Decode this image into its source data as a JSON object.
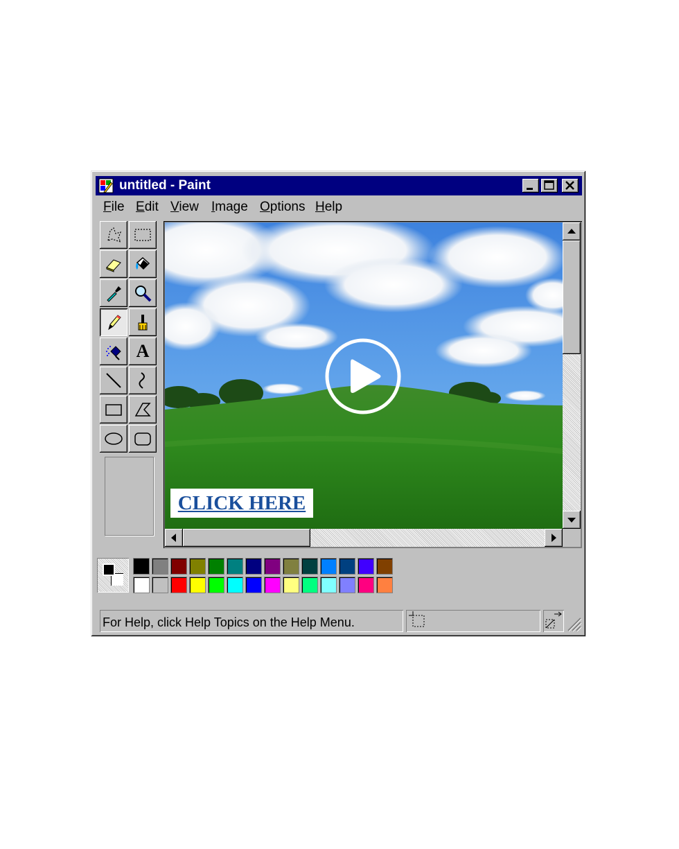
{
  "window": {
    "title": "untitled - Paint",
    "menu": [
      {
        "label": "File"
      },
      {
        "label": "Edit"
      },
      {
        "label": "View"
      },
      {
        "label": "Image"
      },
      {
        "label": "Options"
      },
      {
        "label": "Help"
      }
    ]
  },
  "toolbox": {
    "tools": [
      "free-form-select",
      "rectangle-select",
      "eraser",
      "fill-with-color",
      "pick-color",
      "magnifier",
      "pencil",
      "brush",
      "airbrush",
      "text",
      "line",
      "curve",
      "rectangle",
      "polygon",
      "ellipse",
      "rounded-rectangle"
    ],
    "active_tool": "pencil",
    "text_tool_glyph": "A"
  },
  "canvas": {
    "link_text": "CLICK HERE",
    "play_icon": "play-icon",
    "scene": "green hill under blue sky with clouds"
  },
  "palette": {
    "foreground": "#000000",
    "background": "#ffffff",
    "top_row": [
      "#000000",
      "#808080",
      "#800000",
      "#808000",
      "#008000",
      "#008080",
      "#000080",
      "#800080",
      "#808040",
      "#004040",
      "#0080ff",
      "#004080",
      "#4000ff",
      "#804000"
    ],
    "bottom_row": [
      "#ffffff",
      "#c0c0c0",
      "#ff0000",
      "#ffff00",
      "#00ff00",
      "#00ffff",
      "#0000ff",
      "#ff00ff",
      "#ffff80",
      "#00ff80",
      "#80ffff",
      "#8080ff",
      "#ff0080",
      "#ff8040"
    ]
  },
  "statusbar": {
    "help_text": "For Help, click Help Topics on the Help Menu."
  }
}
